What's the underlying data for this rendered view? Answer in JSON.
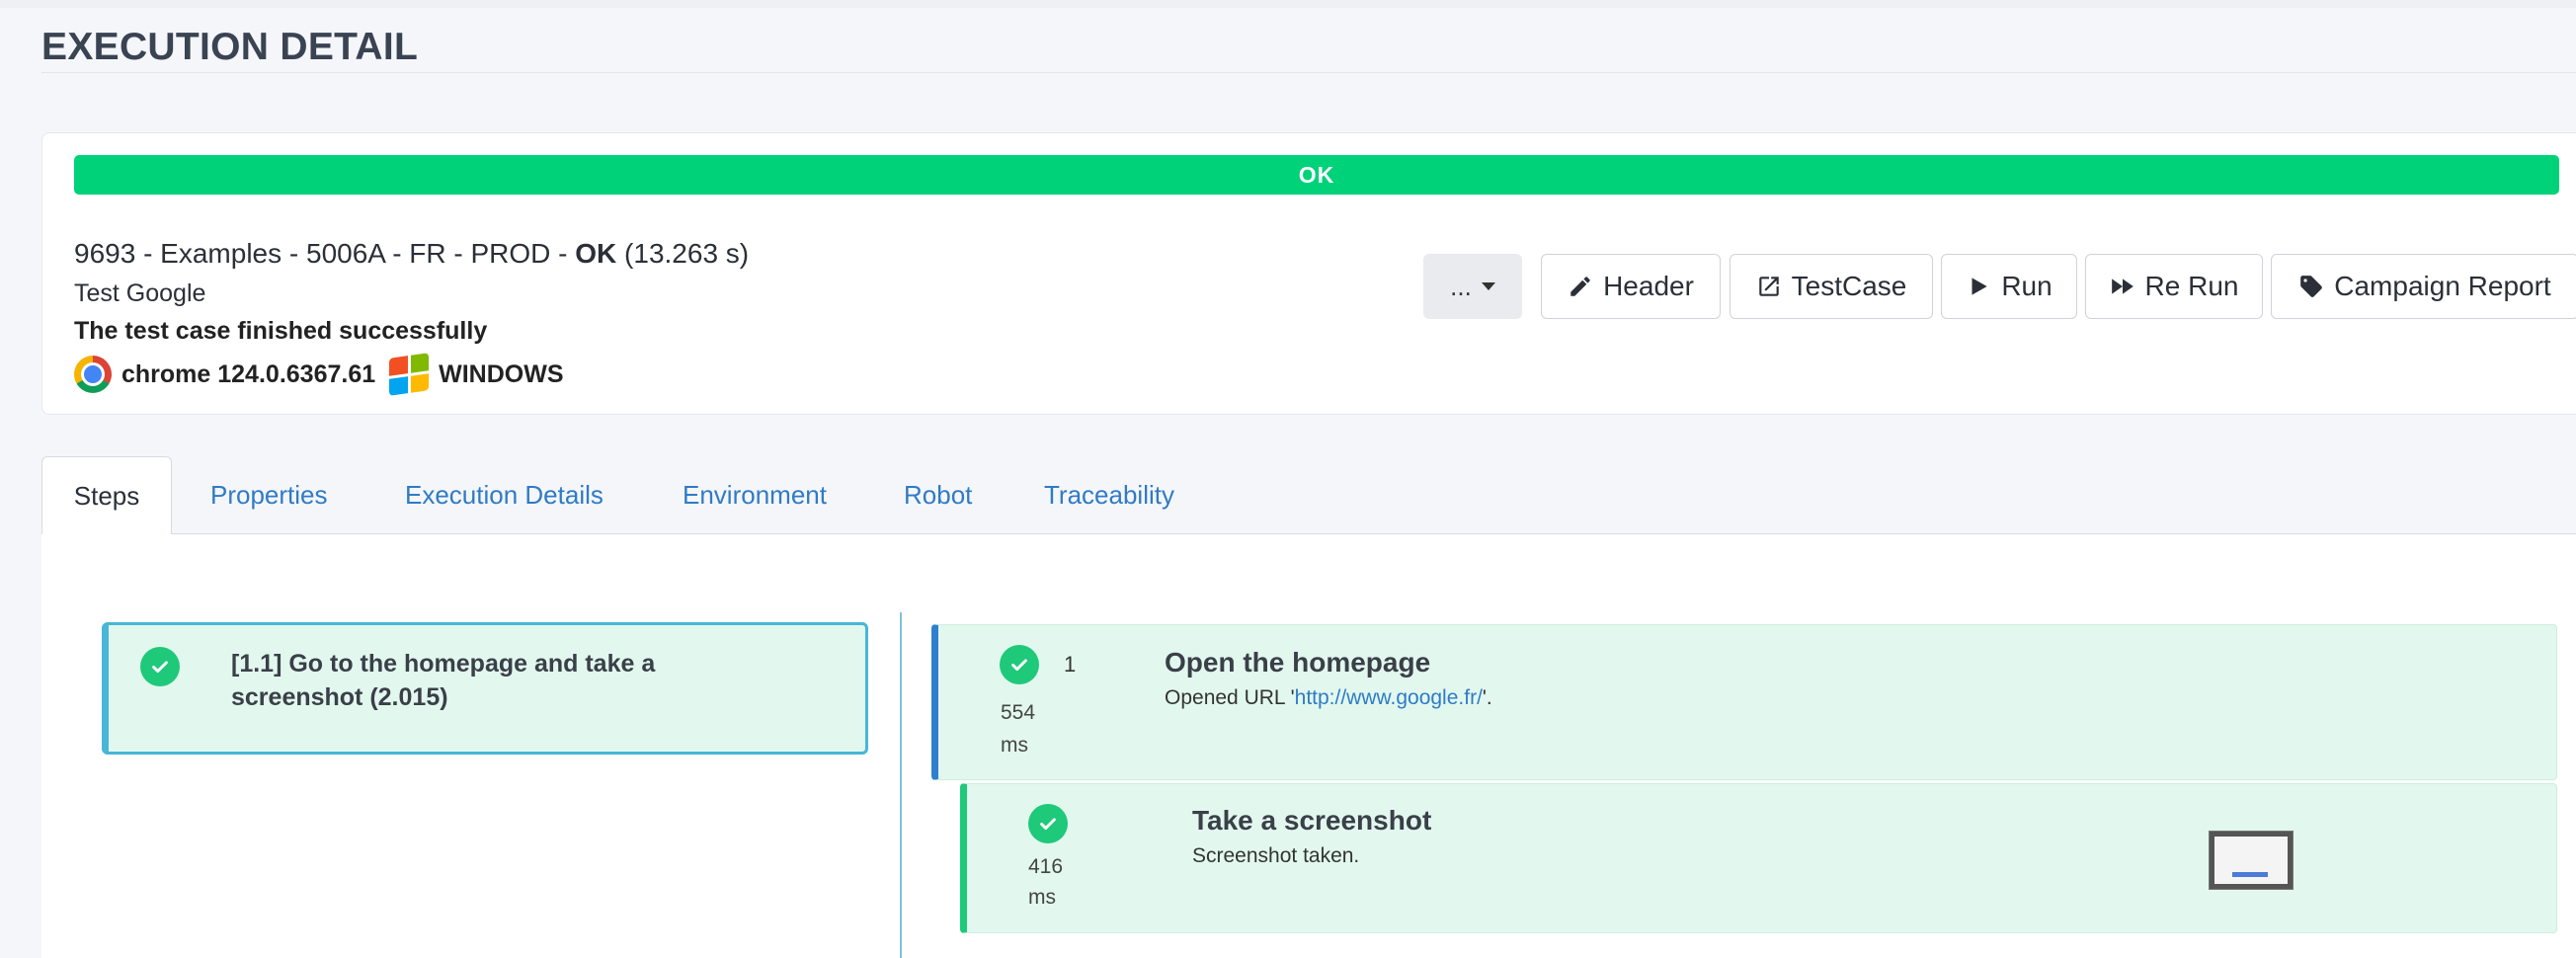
{
  "page": {
    "title": "EXECUTION DETAIL"
  },
  "summary": {
    "status": "OK",
    "exec_prefix": "9693 - Examples - 5006A - FR - PROD - ",
    "exec_status": "OK",
    "exec_duration": " (13.263 s)",
    "description": "Test Google",
    "message": "The test case finished successfully",
    "browser": "chrome 124.0.6367.61",
    "platform": "WINDOWS",
    "browser_icon": "chrome-icon",
    "platform_icon": "windows-icon",
    "status_color": "#00d27a"
  },
  "toolbar": {
    "more_label": "...",
    "header_label": "Header",
    "testcase_label": "TestCase",
    "run_label": "Run",
    "rerun_label": "Re Run",
    "campaign_label": "Campaign Report"
  },
  "tabs": [
    {
      "label": "Steps"
    },
    {
      "label": "Properties"
    },
    {
      "label": "Execution Details"
    },
    {
      "label": "Environment"
    },
    {
      "label": "Robot"
    },
    {
      "label": "Traceability"
    }
  ],
  "steps": [
    {
      "label": "[1.1] Go to the homepage and take a screenshot (2.015)"
    }
  ],
  "actions": [
    {
      "seq": "1",
      "duration_value": "554",
      "duration_unit": "ms",
      "title": "Open the homepage",
      "desc_prefix": "Opened URL '",
      "url": "http://www.google.fr/",
      "desc_suffix": "'."
    }
  ],
  "controls": [
    {
      "duration_value": "416",
      "duration_unit": "ms",
      "title": "Take a screenshot",
      "desc": "Screenshot taken."
    }
  ]
}
